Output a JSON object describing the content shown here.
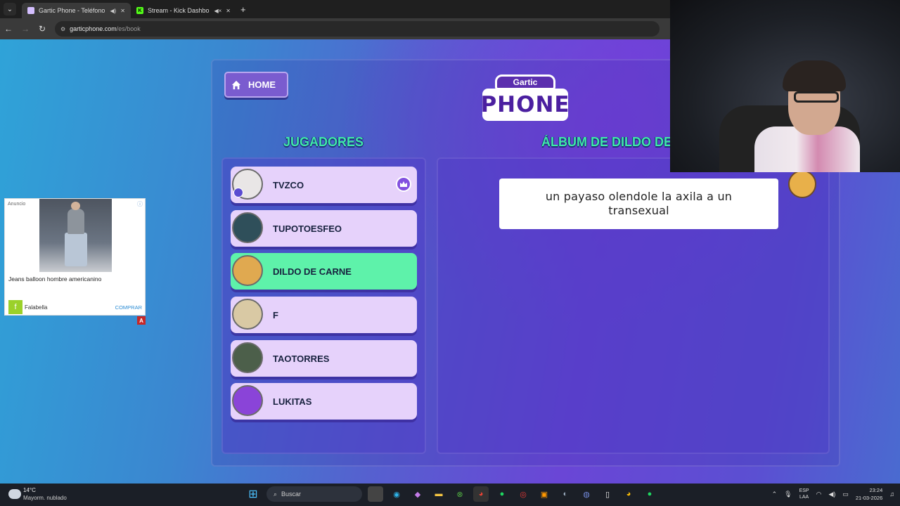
{
  "browser": {
    "tabs": [
      {
        "title": "Gartic Phone - Teléfono De",
        "active": true
      },
      {
        "title": "Stream - Kick Dashboard",
        "active": false
      }
    ],
    "url_host": "garticphone.com",
    "url_path": "/es/book"
  },
  "ad": {
    "label": "Anuncio",
    "product": "Jeans balloon hombre americanino",
    "brand": "Falabella",
    "brand_initial": "f",
    "cta": "COMPRAR",
    "badge": "A"
  },
  "game": {
    "home_label": "HOME",
    "logo_top": "Gartic",
    "logo_main": "PHONE",
    "players_title": "JUGADORES",
    "album_title": "ÁLBUM DE DILDO DE CARNE",
    "players": [
      {
        "name": "TVZCO",
        "host": true,
        "highlight": false
      },
      {
        "name": "TUPOTOESFEO",
        "host": false,
        "highlight": false
      },
      {
        "name": "DILDO DE CARNE",
        "host": false,
        "highlight": true
      },
      {
        "name": "F",
        "host": false,
        "highlight": false
      },
      {
        "name": "TAOTORRES",
        "host": false,
        "highlight": false
      },
      {
        "name": "LUKITAS",
        "host": false,
        "highlight": false
      }
    ],
    "album_entry": "un payaso olendole la axila a un transexual"
  },
  "taskbar": {
    "temp": "14°C",
    "weather": "Mayorm. nublado",
    "search_placeholder": "Buscar",
    "lang_top": "ESP",
    "lang_bottom": "LAA",
    "time": "23:24",
    "date": "21-03-2026"
  },
  "colors": {
    "accent_green": "#3fe8a8",
    "player_card": "#e6d2fb",
    "player_highlight": "#5ef2aa"
  }
}
